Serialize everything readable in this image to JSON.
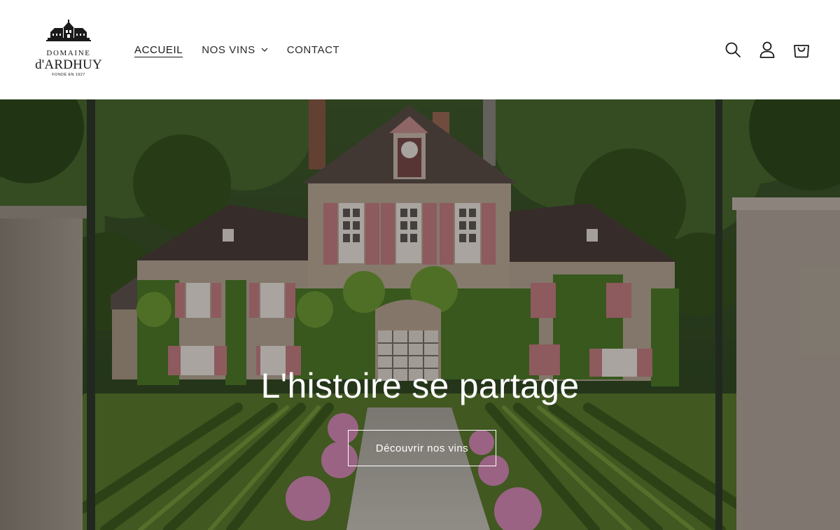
{
  "header": {
    "logo": {
      "line1": "DOMAINE",
      "line2": "d'ARDHUY",
      "line3": "FONDÉ EN 1927",
      "icon": "chateau-icon"
    },
    "nav": [
      {
        "label": "ACCUEIL",
        "active": true
      },
      {
        "label": "NOS VINS",
        "has_dropdown": true,
        "icon": "chevron-down-icon"
      },
      {
        "label": "CONTACT"
      }
    ],
    "icons": [
      "search-icon",
      "account-icon",
      "cart-icon"
    ]
  },
  "hero": {
    "title": "L'histoire se partage",
    "button_label": "Découvrir nos vins",
    "image_subject": "château-with-vineyard",
    "overlay_color": "#000000"
  },
  "colors": {
    "header_bg": "#ffffff",
    "text": "#1a1a1a",
    "hero_text": "#ffffff"
  }
}
